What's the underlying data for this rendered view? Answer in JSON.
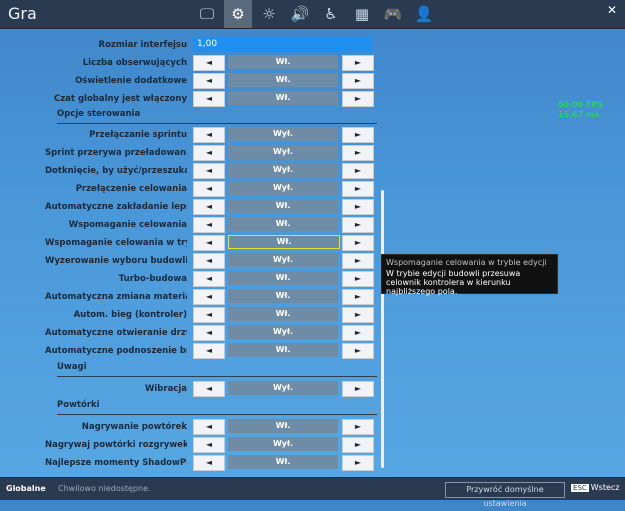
{
  "header": {
    "title": "Gra",
    "tabs": [
      {
        "name": "monitor",
        "glyph": "🖵",
        "active": false
      },
      {
        "name": "gear",
        "glyph": "⚙",
        "active": true
      },
      {
        "name": "sun",
        "glyph": "☼",
        "active": false
      },
      {
        "name": "volume",
        "glyph": "🔊",
        "active": false
      },
      {
        "name": "accessibility",
        "glyph": "♿",
        "active": false
      },
      {
        "name": "network",
        "glyph": "▦",
        "active": false
      },
      {
        "name": "gamepad",
        "glyph": "🎮",
        "active": false
      },
      {
        "name": "user",
        "glyph": "👤",
        "active": false
      }
    ],
    "close": "✕"
  },
  "settings": {
    "ui_size": {
      "label": "Rozmiar interfejsu",
      "value": "1,00"
    },
    "items_top": [
      {
        "label": "Liczba obserwujących",
        "value": "Wł."
      },
      {
        "label": "Oświetlenie dodatkowe",
        "value": "Wł."
      },
      {
        "label": "Czat globalny jest włączony",
        "value": "Wł."
      }
    ],
    "section_control": "Opcje sterowania",
    "items_control": [
      {
        "label": "Przełączanie sprintu",
        "value": "Wył."
      },
      {
        "label": "Sprint przerywa przeładowanie",
        "value": "Wył."
      },
      {
        "label": "Dotknięcie, by użyć/przeszukać",
        "value": "Wył."
      },
      {
        "label": "Przełączenie celowania",
        "value": "Wył."
      },
      {
        "label": "Automatyczne zakładanie lepszego s",
        "value": "Wł."
      },
      {
        "label": "Wspomaganie celowania",
        "value": "Wł."
      },
      {
        "label": "Wspomaganie celowania w trybie edycji",
        "value": "Wł.",
        "focused": true
      },
      {
        "label": "Wyzerowanie wyboru budowli",
        "value": "Wył."
      },
      {
        "label": "Turbo-budowa",
        "value": "Wł."
      },
      {
        "label": "Automatyczna zmiana materiału",
        "value": "Wł."
      },
      {
        "label": "Autom. bieg (kontroler)",
        "value": "Wł."
      },
      {
        "label": "Automatyczne otwieranie drzwi",
        "value": "Wył."
      },
      {
        "label": "Automatyczne podnoszenie broni",
        "value": "Wł."
      }
    ],
    "section_warnings": "Uwagi",
    "items_warnings": [
      {
        "label": "Wibracja",
        "value": "Wył."
      }
    ],
    "section_replays": "Powtórki",
    "items_replays": [
      {
        "label": "Nagrywanie powtórek",
        "value": "Wł."
      },
      {
        "label": "Nagrywaj powtórki rozgrywek du",
        "value": "Wył."
      },
      {
        "label": "Najlepsze momenty ShadowPlay",
        "value": "Wł."
      }
    ],
    "arrow_left": "◄",
    "arrow_right": "►"
  },
  "tooltip": {
    "title": "Wspomaganie celowania w trybie edycji",
    "text": "W trybie edycji budowli przesuwa celownik kontrolera w kierunku najbliższego pola."
  },
  "fps": {
    "fps": "60.00 FPS",
    "ms": "15.67 ms"
  },
  "footer": {
    "left": "Globalne",
    "status": "Chwilowo niedostępne.",
    "reset": "Przywróć domyślne ustawienia",
    "esc": "ESC",
    "back": "Wstecz"
  },
  "colors": {
    "accent": "#1f8ff2",
    "focus": "#e7e32b",
    "fps": "#28d25f"
  }
}
